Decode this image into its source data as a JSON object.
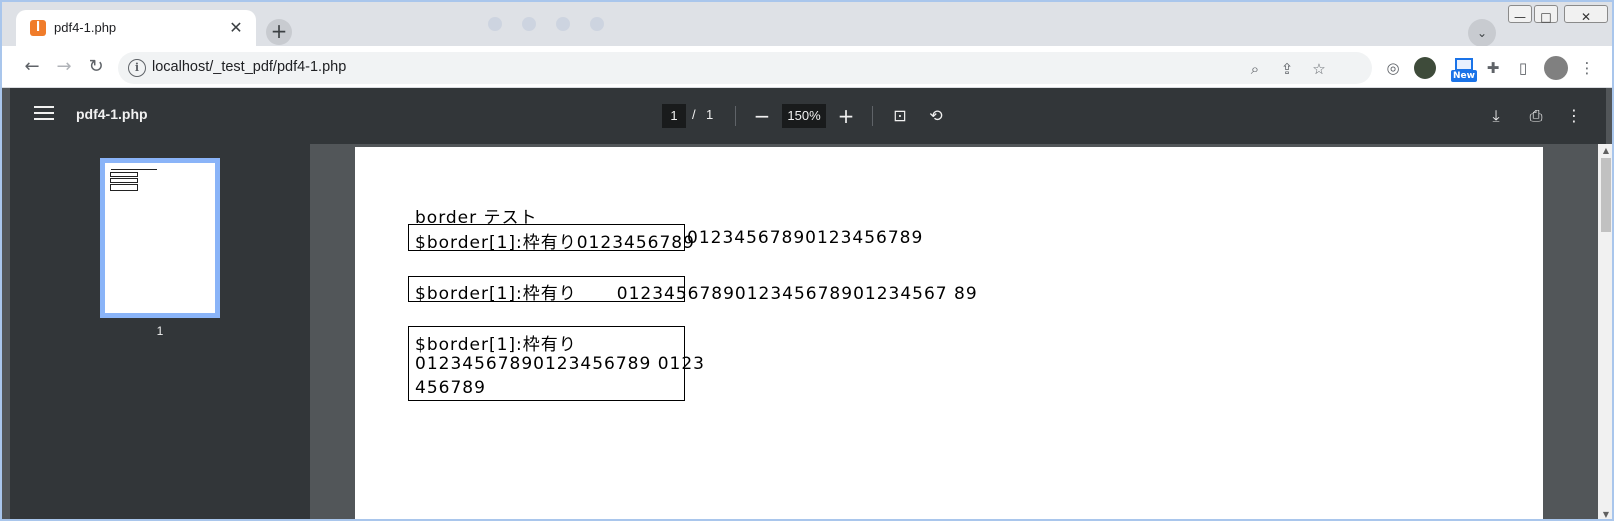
{
  "browser": {
    "tab": {
      "favicon": "xampp-favicon",
      "title": "pdf4-1.php",
      "close": "✕"
    },
    "new_tab": "+",
    "tab_search": "⌄",
    "window_controls": {
      "minimize": "—",
      "maximize": "□",
      "close": "✕"
    },
    "nav": {
      "back": "←",
      "forward": "→",
      "reload": "↻"
    },
    "omnibox": {
      "info_icon": "i",
      "url": "localhost/_test_pdf/pdf4-1.php"
    },
    "toolbar_icons": [
      "zoom-icon",
      "share-icon",
      "star-icon",
      "extension-icon",
      "puzzle-icon",
      "sidepanel-icon",
      "profile-avatar",
      "menu-icon"
    ],
    "new_badge": "New"
  },
  "pdf_viewer": {
    "title": "pdf4-1.php",
    "page_current": "1",
    "page_separator": "/",
    "page_total": "1",
    "zoom_out": "−",
    "zoom_level": "150%",
    "zoom_in": "+",
    "thumbnail_page_label": "1"
  },
  "pdf_content": {
    "heading": "border テスト",
    "line1_boxed": "$border[1]:枠有り0123456789",
    "line1_overflow": "01234567890123456789",
    "line2_boxed": "$border[1]:枠有り　　01234",
    "line2_overflow": "567890123456789012345678 9",
    "line2_full": "$border[1]:枠有り      0123456789012345678901234567 89",
    "box3_line1": "$border[1]:枠有り",
    "box3_line2": "01234567890123456789 0123",
    "box3_line3": "456789"
  }
}
